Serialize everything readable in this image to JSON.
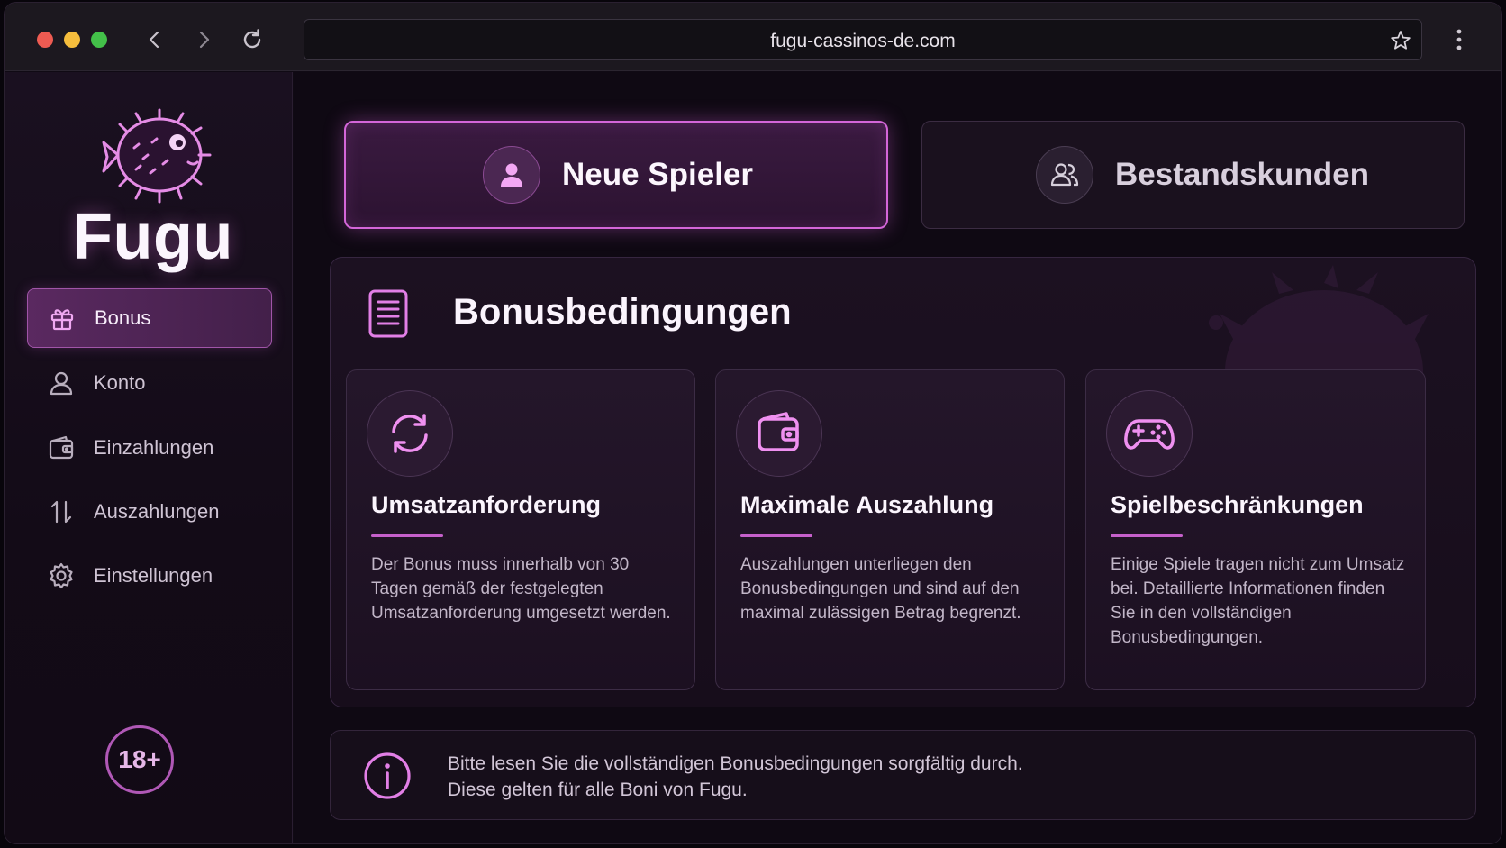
{
  "browser": {
    "url": "fugu-cassinos-de.com",
    "icons": [
      "back-icon",
      "forward-icon",
      "reload-icon",
      "star-icon",
      "more-vertical-icon"
    ]
  },
  "sidebar": {
    "brand": "Fugu",
    "items": [
      {
        "label": "Bonus",
        "icon": "gift-icon",
        "active": true
      },
      {
        "label": "Konto",
        "icon": "user-icon",
        "active": false
      },
      {
        "label": "Einzahlungen",
        "icon": "wallet-icon",
        "active": false
      },
      {
        "label": "Auszahlungen",
        "icon": "transfer-icon",
        "active": false
      },
      {
        "label": "Einstellungen",
        "icon": "gear-icon",
        "active": false
      }
    ],
    "age_badge": "18+"
  },
  "tabs": [
    {
      "label": "Neue Spieler",
      "icon": "user-icon",
      "active": true
    },
    {
      "label": "Bestandskunden",
      "icon": "users-icon",
      "active": false
    }
  ],
  "panel": {
    "title": "Bonusbedingungen",
    "cards": [
      {
        "title": "Umsatzanforderung",
        "icon": "refresh-icon",
        "text": "Der Bonus muss innerhalb von 30 Tagen gemäß der festgelegten Umsatzanforderung umgesetzt werden."
      },
      {
        "title": "Maximale Auszahlung",
        "icon": "wallet-icon",
        "text": "Auszahlungen unterliegen den Bonusbedingungen und sind auf den maximal zulässigen Betrag begrenzt."
      },
      {
        "title": "Spielbeschränkungen",
        "icon": "gamepad-icon",
        "text": "Einige Spiele tragen nicht zum Umsatz bei. Detaillierte Informationen finden Sie in den vollständigen Bonusbedingungen."
      }
    ]
  },
  "notice": {
    "line1": "Bitte lesen Sie die vollständigen Bonusbedingungen sorgfältig durch.",
    "line2": "Diese gelten für alle Boni von Fugu."
  },
  "colors": {
    "accent": "#d466d9",
    "background": "#0f0913",
    "sidebar": "#1a1020"
  }
}
